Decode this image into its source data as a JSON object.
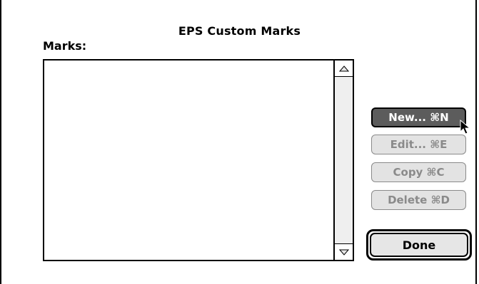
{
  "dialog": {
    "title": "EPS Custom Marks",
    "list_label": "Marks:",
    "marks": []
  },
  "buttons": {
    "new": "New... ⌘N",
    "edit": "Edit... ⌘E",
    "copy": "Copy ⌘C",
    "delete": "Delete ⌘D",
    "done": "Done"
  },
  "icons": {
    "scroll_up": "triangle-up-icon",
    "scroll_down": "triangle-down-icon",
    "pointer": "arrow-cursor-icon"
  }
}
